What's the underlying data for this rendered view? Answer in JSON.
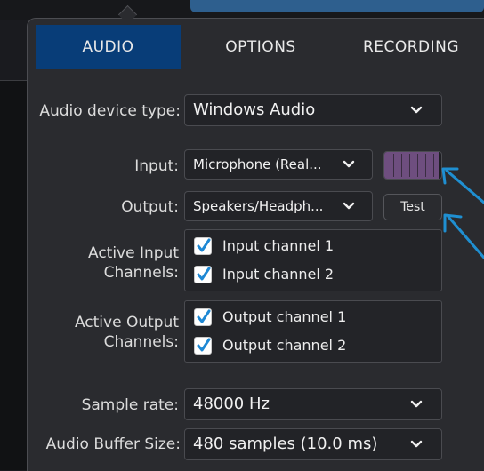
{
  "tabs": [
    {
      "label": "AUDIO",
      "active": true
    },
    {
      "label": "OPTIONS",
      "active": false
    },
    {
      "label": "RECORDING",
      "active": false
    }
  ],
  "device_type": {
    "label": "Audio device type:",
    "value": "Windows Audio"
  },
  "input": {
    "label": "Input:",
    "value": "Microphone (Real..."
  },
  "output": {
    "label": "Output:",
    "value": "Speakers/Headph..."
  },
  "test_button": {
    "label": "Test"
  },
  "level_meter": {
    "level": 0.95,
    "color": "#6e4e7f"
  },
  "active_input": {
    "label_line1": "Active Input",
    "label_line2": "Channels:",
    "channels": [
      {
        "label": "Input channel 1",
        "checked": true
      },
      {
        "label": "Input channel 2",
        "checked": true
      }
    ]
  },
  "active_output": {
    "label_line1": "Active Output",
    "label_line2": "Channels:",
    "channels": [
      {
        "label": "Output channel 1",
        "checked": true
      },
      {
        "label": "Output channel 2",
        "checked": true
      }
    ]
  },
  "sample_rate": {
    "label": "Sample rate:",
    "value": "48000 Hz"
  },
  "buffer_size": {
    "label": "Audio Buffer Size:",
    "value": "480 samples (10.0 ms)"
  },
  "colors": {
    "active_tab": "#083d78",
    "checkbox_check": "#1e88d4",
    "annotation_arrow": "#1f8fd1"
  },
  "icons": {
    "dropdown": "chevron-down-icon",
    "checkbox": "checkmark-icon",
    "annotation": "arrow-icon"
  }
}
